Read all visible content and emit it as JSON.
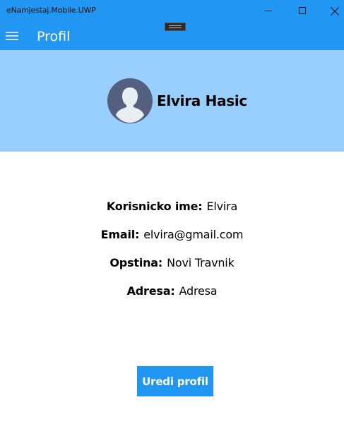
{
  "window": {
    "title": "eNamjestaj.Mobile.UWP"
  },
  "appbar": {
    "title": "Profil"
  },
  "profile": {
    "name": "Elvira Hasic"
  },
  "info": {
    "username_label": "Korisnicko ime:",
    "username_value": "Elvira",
    "email_label": "Email:",
    "email_value": "elvira@gmail.com",
    "opstina_label": "Opstina:",
    "opstina_value": "Novi Travnik",
    "adresa_label": "Adresa:",
    "adresa_value": "Adresa"
  },
  "actions": {
    "edit_label": "Uredi profil"
  },
  "colors": {
    "accent": "#2196f3",
    "header_bg": "#99cfff",
    "avatar_bg": "#556080"
  },
  "icons": {
    "menu": "hamburger-menu-icon",
    "avatar": "user-silhouette-icon",
    "minimize": "minimize-icon",
    "maximize": "maximize-icon",
    "close": "close-icon"
  }
}
